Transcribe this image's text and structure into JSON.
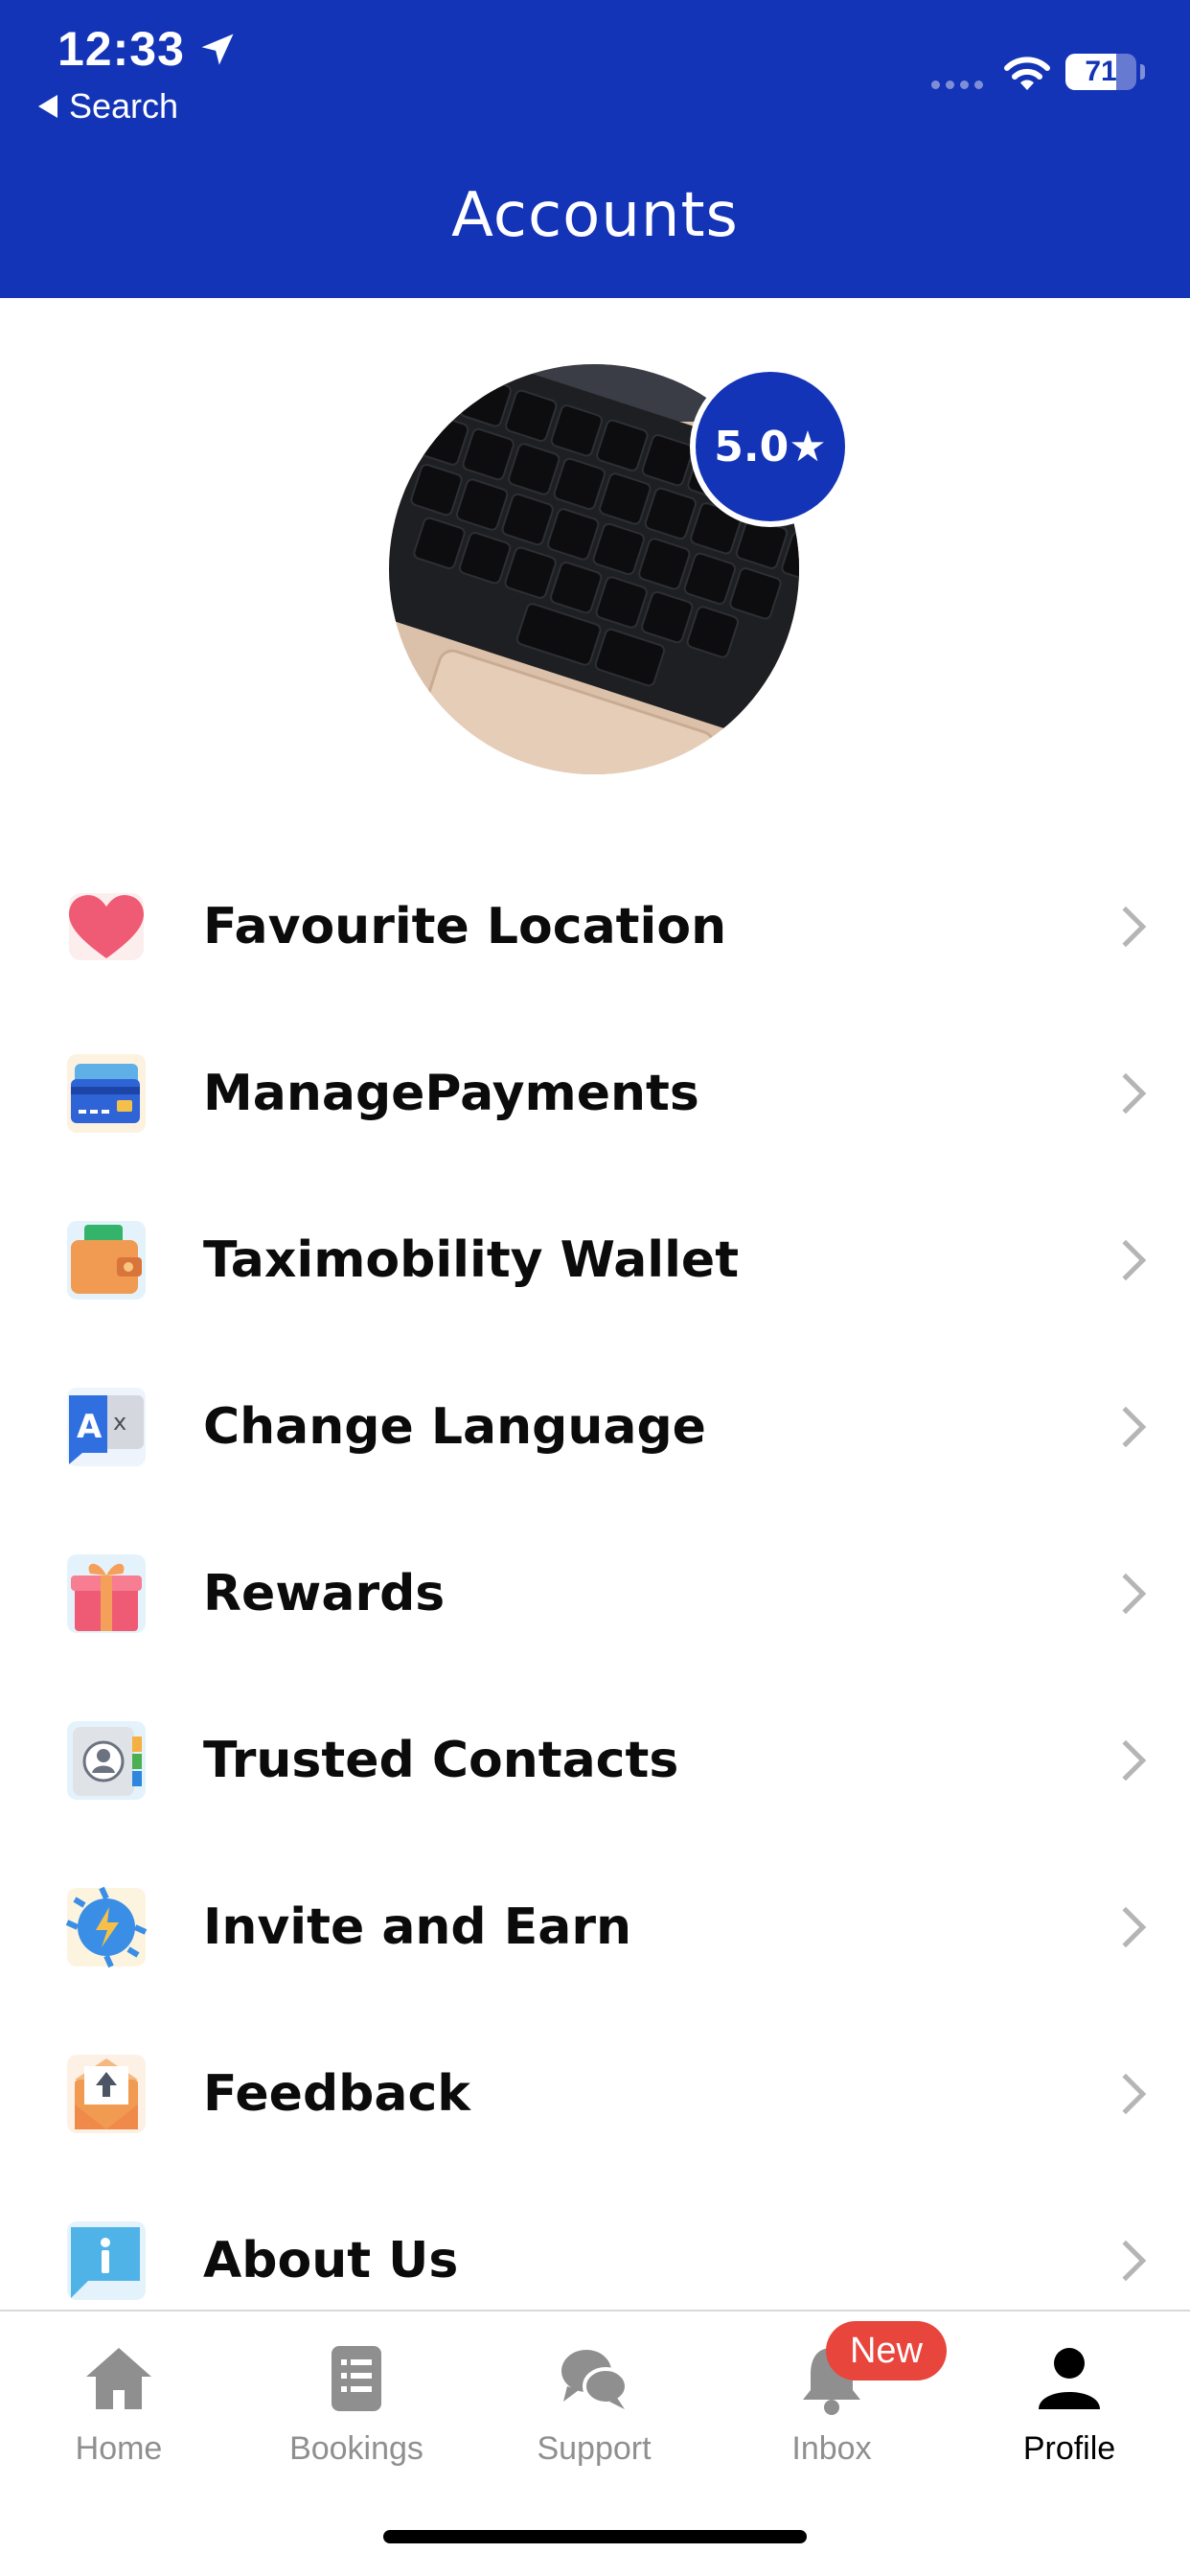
{
  "status_bar": {
    "time": "12:33",
    "back_label": "Search",
    "battery": "71"
  },
  "header": {
    "title": "Accounts"
  },
  "profile": {
    "rating": "5.0★"
  },
  "menu": {
    "items": [
      {
        "label": "Favourite Location",
        "icon": "heart-icon"
      },
      {
        "label": "ManagePayments",
        "icon": "credit-card-icon"
      },
      {
        "label": "Taximobility Wallet",
        "icon": "wallet-icon"
      },
      {
        "label": "Change Language",
        "icon": "translate-icon"
      },
      {
        "label": "Rewards",
        "icon": "gift-icon"
      },
      {
        "label": "Trusted Contacts",
        "icon": "contacts-icon"
      },
      {
        "label": "Invite and Earn",
        "icon": "invite-icon"
      },
      {
        "label": "Feedback",
        "icon": "feedback-icon"
      },
      {
        "label": "About Us",
        "icon": "info-icon"
      }
    ]
  },
  "bottom_nav": {
    "items": [
      {
        "label": "Home",
        "icon": "home-icon"
      },
      {
        "label": "Bookings",
        "icon": "bookings-icon"
      },
      {
        "label": "Support",
        "icon": "support-icon"
      },
      {
        "label": "Inbox",
        "icon": "bell-icon"
      },
      {
        "label": "Profile",
        "icon": "profile-icon",
        "active": true
      }
    ],
    "inbox_badge": "New"
  },
  "colors": {
    "brand": "#1434b8",
    "badge": "#e8453c"
  }
}
